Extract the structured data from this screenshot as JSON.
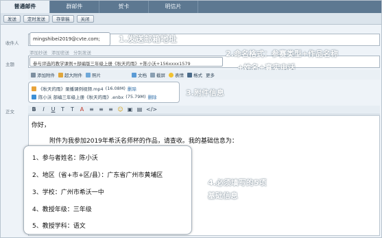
{
  "tabs": [
    "普通邮件",
    "群邮件",
    "贺卡",
    "明信片"
  ],
  "toolbar": [
    "发送",
    "定时发送",
    "存草稿",
    "关闭"
  ],
  "form": {
    "to_label": "收件人",
    "to_value": "mingshibei2019@cvte.com;",
    "addr_links": [
      "添加抄送",
      "添加密送",
      "分别发送"
    ],
    "subject_label": "主题",
    "subject_value": "参与评选的教学课例+部编版三年级上册《秋天的雨》+陈小沃+156xxxx1579",
    "body_label": "正文"
  },
  "attachments_bar": [
    "添加附件",
    "超大附件",
    "照片",
    "文档",
    "截屏",
    "表情",
    "格式",
    "更多"
  ],
  "attachments": [
    {
      "name": "《秋天的雨》录播课例视频.mp4",
      "size": "(16.08M)",
      "action": "删除"
    },
    {
      "name": "陈小沃 部编三年级上册《秋天的雨》.enbx",
      "size": "(75.79M)",
      "action": "删除"
    }
  ],
  "format_tools": [
    "B",
    "I",
    "U",
    "T",
    "T",
    "A",
    "≡",
    "≡",
    "≡",
    "☺",
    "▣",
    "▤",
    "</>"
  ],
  "body": {
    "greeting": "你好，",
    "intro": "附件为我参加2019年希沃名师杯的作品，请查收。我的基础信息为：",
    "info": [
      "1、参与者姓名：陈小沃",
      "2、地区（省+市+区/县）：广东省广州市黄埔区",
      "3、学校：广州市希沃一中",
      "4、教授年级：三年级",
      "5、教授学科：语文"
    ]
  },
  "annotations": {
    "a1": "1.发送邮箱地址",
    "a2_line1": "2.命名格式：参赛类型+作品名称",
    "a2_line2": "+姓名+真实电话",
    "a3": "3.附件信息",
    "a4_line1": "4.必须填写的5项",
    "a4_line2": "基础信息"
  },
  "colors": {
    "tab_bar": "#5d7891",
    "link": "#2f6ea8",
    "callout_text": "#ffffff"
  }
}
